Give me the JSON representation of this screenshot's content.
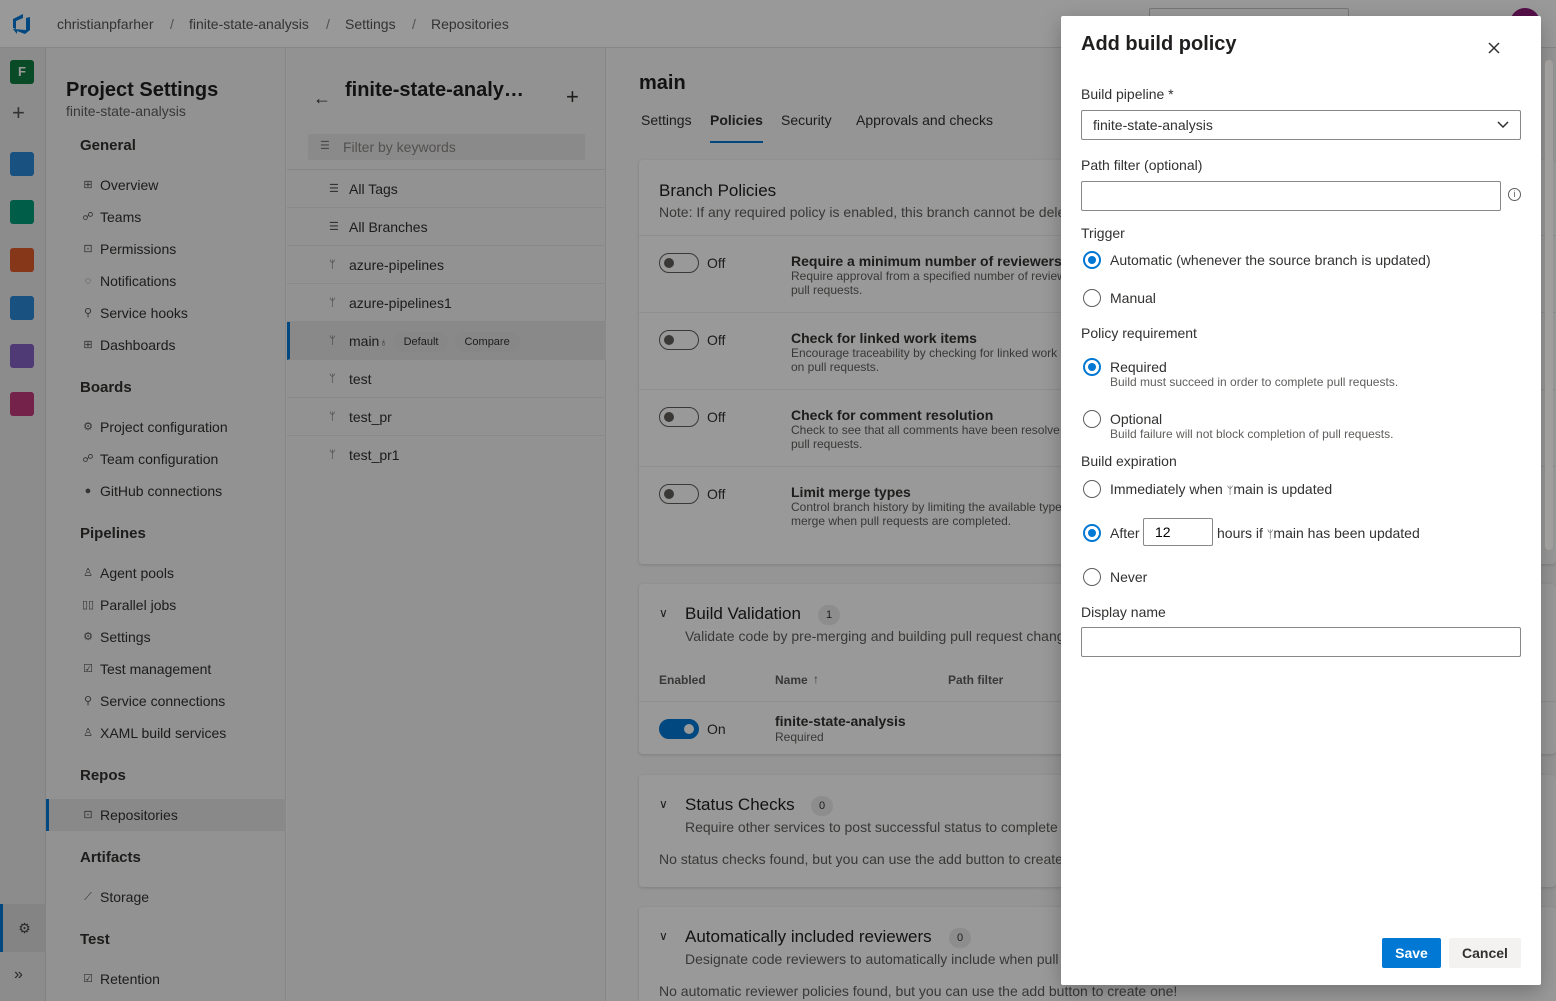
{
  "breadcrumb": [
    "christianpfarher",
    "finite-state-analysis",
    "Settings",
    "Repositories"
  ],
  "rail": {
    "project_initial": "F",
    "colors": {
      "project": "#107c41",
      "boards": "#0078d4",
      "repos": "#d13438",
      "pipelines": "#2b88d8",
      "testplans": "#8661c5",
      "artifacts": "#c239b3"
    }
  },
  "settings_nav": {
    "title": "Project Settings",
    "subtitle": "finite-state-analysis",
    "sections": [
      {
        "name": "General",
        "items": [
          "Overview",
          "Teams",
          "Permissions",
          "Notifications",
          "Service hooks",
          "Dashboards"
        ]
      },
      {
        "name": "Boards",
        "items": [
          "Project configuration",
          "Team configuration",
          "GitHub connections"
        ]
      },
      {
        "name": "Pipelines",
        "items": [
          "Agent pools",
          "Parallel jobs",
          "Settings",
          "Test management",
          "Service connections",
          "XAML build services"
        ]
      },
      {
        "name": "Repos",
        "items": [
          "Repositories"
        ]
      },
      {
        "name": "Artifacts",
        "items": [
          "Storage"
        ]
      },
      {
        "name": "Test",
        "items": [
          "Retention"
        ]
      }
    ],
    "active_item": "Repositories"
  },
  "branch_panel": {
    "title": "finite-state-analy…",
    "filter_placeholder": "Filter by keywords",
    "rows": [
      "All Tags",
      "All Branches",
      "azure-pipelines",
      "azure-pipelines1",
      "main",
      "test",
      "test_pr",
      "test_pr1"
    ],
    "selected": "main",
    "default_badge": "Default",
    "compare_badge": "Compare"
  },
  "main": {
    "branch": "main",
    "tabs": [
      "Settings",
      "Policies",
      "Security",
      "Approvals and checks"
    ],
    "active_tab": "Policies",
    "branch_policies": {
      "title": "Branch Policies",
      "note": "Note: If any required policy is enabled, this branch cannot be dele",
      "policies": [
        {
          "state": "Off",
          "title": "Require a minimum number of reviewers",
          "desc": [
            "Require approval from a specified number of review",
            "pull requests."
          ]
        },
        {
          "state": "Off",
          "title": "Check for linked work items",
          "desc": [
            "Encourage traceability by checking for linked work",
            "on pull requests."
          ]
        },
        {
          "state": "Off",
          "title": "Check for comment resolution",
          "desc": [
            "Check to see that all comments have been resolve",
            "pull requests."
          ]
        },
        {
          "state": "Off",
          "title": "Limit merge types",
          "desc": [
            "Control branch history by limiting the available type",
            "merge when pull requests are completed."
          ]
        }
      ]
    },
    "build_validation": {
      "title": "Build Validation",
      "count": "1",
      "desc": "Validate code by pre-merging and building pull request chang",
      "columns": [
        "Enabled",
        "Name",
        "Path filter"
      ],
      "row": {
        "state": "On",
        "name": "finite-state-analysis",
        "requirement": "Required"
      }
    },
    "status_checks": {
      "title": "Status Checks",
      "count": "0",
      "desc": "Require other services to post successful status to complete",
      "empty": "No status checks found, but you can use the add button to create"
    },
    "auto_reviewers": {
      "title": "Automatically included reviewers",
      "count": "0",
      "desc": "Designate code reviewers to automatically include when pull",
      "empty": "No automatic reviewer policies found, but you can use the add button to create one!"
    }
  },
  "dialog": {
    "title": "Add build policy",
    "pipeline_label": "Build pipeline *",
    "pipeline_value": "finite-state-analysis",
    "path_filter_label": "Path filter (optional)",
    "path_filter_value": "",
    "trigger_label": "Trigger",
    "trigger_options": [
      "Automatic (whenever the source branch is updated)",
      "Manual"
    ],
    "trigger_selected": 0,
    "requirement_label": "Policy requirement",
    "requirement_options": [
      {
        "label": "Required",
        "desc": "Build must succeed in order to complete pull requests."
      },
      {
        "label": "Optional",
        "desc": "Build failure will not block completion of pull requests."
      }
    ],
    "requirement_selected": 0,
    "expiration_label": "Build expiration",
    "expiration_immediate": [
      "Immediately when",
      "main is updated"
    ],
    "expiration_after": [
      "After",
      "hours if",
      "main has been updated"
    ],
    "expiration_hours": "12",
    "expiration_never": "Never",
    "expiration_selected": 1,
    "display_name_label": "Display name",
    "display_name_value": "",
    "save_label": "Save",
    "cancel_label": "Cancel",
    "accent": "#0078d4"
  }
}
